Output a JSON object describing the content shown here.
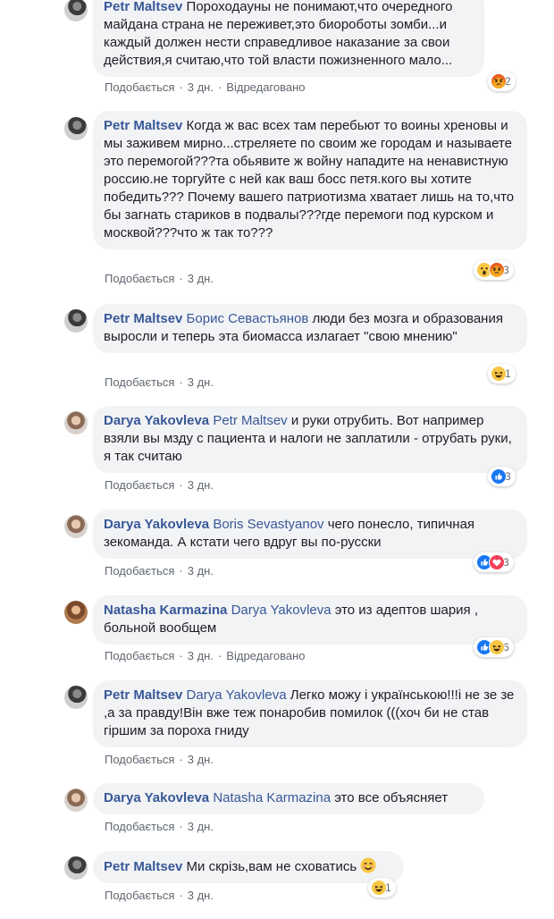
{
  "labels": {
    "like": "Подобається",
    "edited": "Відредаговано"
  },
  "comments": [
    {
      "author": "Petr Maltsev",
      "mention": "",
      "text": "Пороходауны не понимают,что очередного майдана страна не переживет,это биороботы зомби...и каждый должен нести справедливое наказание за свои действия,я считаю,что той власти пожизненного мало...",
      "time": "3 дн.",
      "edited": true,
      "reactions": [
        "angry"
      ],
      "reaction_count": "2"
    },
    {
      "author": "Petr Maltsev",
      "mention": "",
      "text": "Когда ж вас всех там перебьют то воины хреновы и мы заживем мирно...стреляете по своим же городам и называете это перемогой???та обьявите ж войну нападите на ненавистную россию.не торгуйте с ней как ваш босс петя.кого вы хотите победить??? Почему вашего патриотизма хватает лишь на то,что бы загнать стариков в подвалы???где перемоги под курском и москвой???что ж так то???",
      "time": "3 дн.",
      "edited": false,
      "reactions": [
        "wow",
        "angry"
      ],
      "reaction_count": "3"
    },
    {
      "author": "Petr Maltsev",
      "mention": "Борис Севастьянов",
      "text": "люди без мозга и образования выросли и теперь эта биомасса излагает \"свою мнению\"",
      "time": "3 дн.",
      "edited": false,
      "reactions": [
        "haha"
      ],
      "reaction_count": "1"
    },
    {
      "author": "Darya Yakovleva",
      "mention": "Petr Maltsev",
      "text": "и руки отрубить. Вот например взяли вы мзду с пациента и налоги не заплатили - отрубать руки, я так считаю",
      "time": "3 дн.",
      "edited": false,
      "reactions": [
        "like"
      ],
      "reaction_count": "3"
    },
    {
      "author": "Darya Yakovleva",
      "mention": "Boris Sevastyanov",
      "text": "чего понесло, типичная зекоманда. А кстати чего вдруг вы по-русски",
      "time": "3 дн.",
      "edited": false,
      "reactions": [
        "like",
        "love"
      ],
      "reaction_count": "3"
    },
    {
      "author": "Natasha Karmazina",
      "mention": "Darya Yakovleva",
      "text": "это из адептов шария , больной вообщем",
      "time": "3 дн.",
      "edited": true,
      "reactions": [
        "like",
        "haha"
      ],
      "reaction_count": "6"
    },
    {
      "author": "Petr Maltsev",
      "mention": "Darya Yakovleva",
      "text": "Легко можу і українською!!!і не зе зе ,а за правду!Він вже теж понаробив помилок (((хоч би не став гіршим за пороха гниду",
      "time": "3 дн.",
      "edited": false,
      "reactions": [],
      "reaction_count": ""
    },
    {
      "author": "Darya Yakovleva",
      "mention": "Natasha Karmazina",
      "text": "это все объясняет",
      "time": "3 дн.",
      "edited": false,
      "reactions": [],
      "reaction_count": ""
    },
    {
      "author": "Petr Maltsev",
      "mention": "",
      "text": "Ми скрізь,вам не сховатись",
      "time": "3 дн.",
      "edited": false,
      "reactions": [
        "haha"
      ],
      "reaction_count": "1"
    }
  ]
}
